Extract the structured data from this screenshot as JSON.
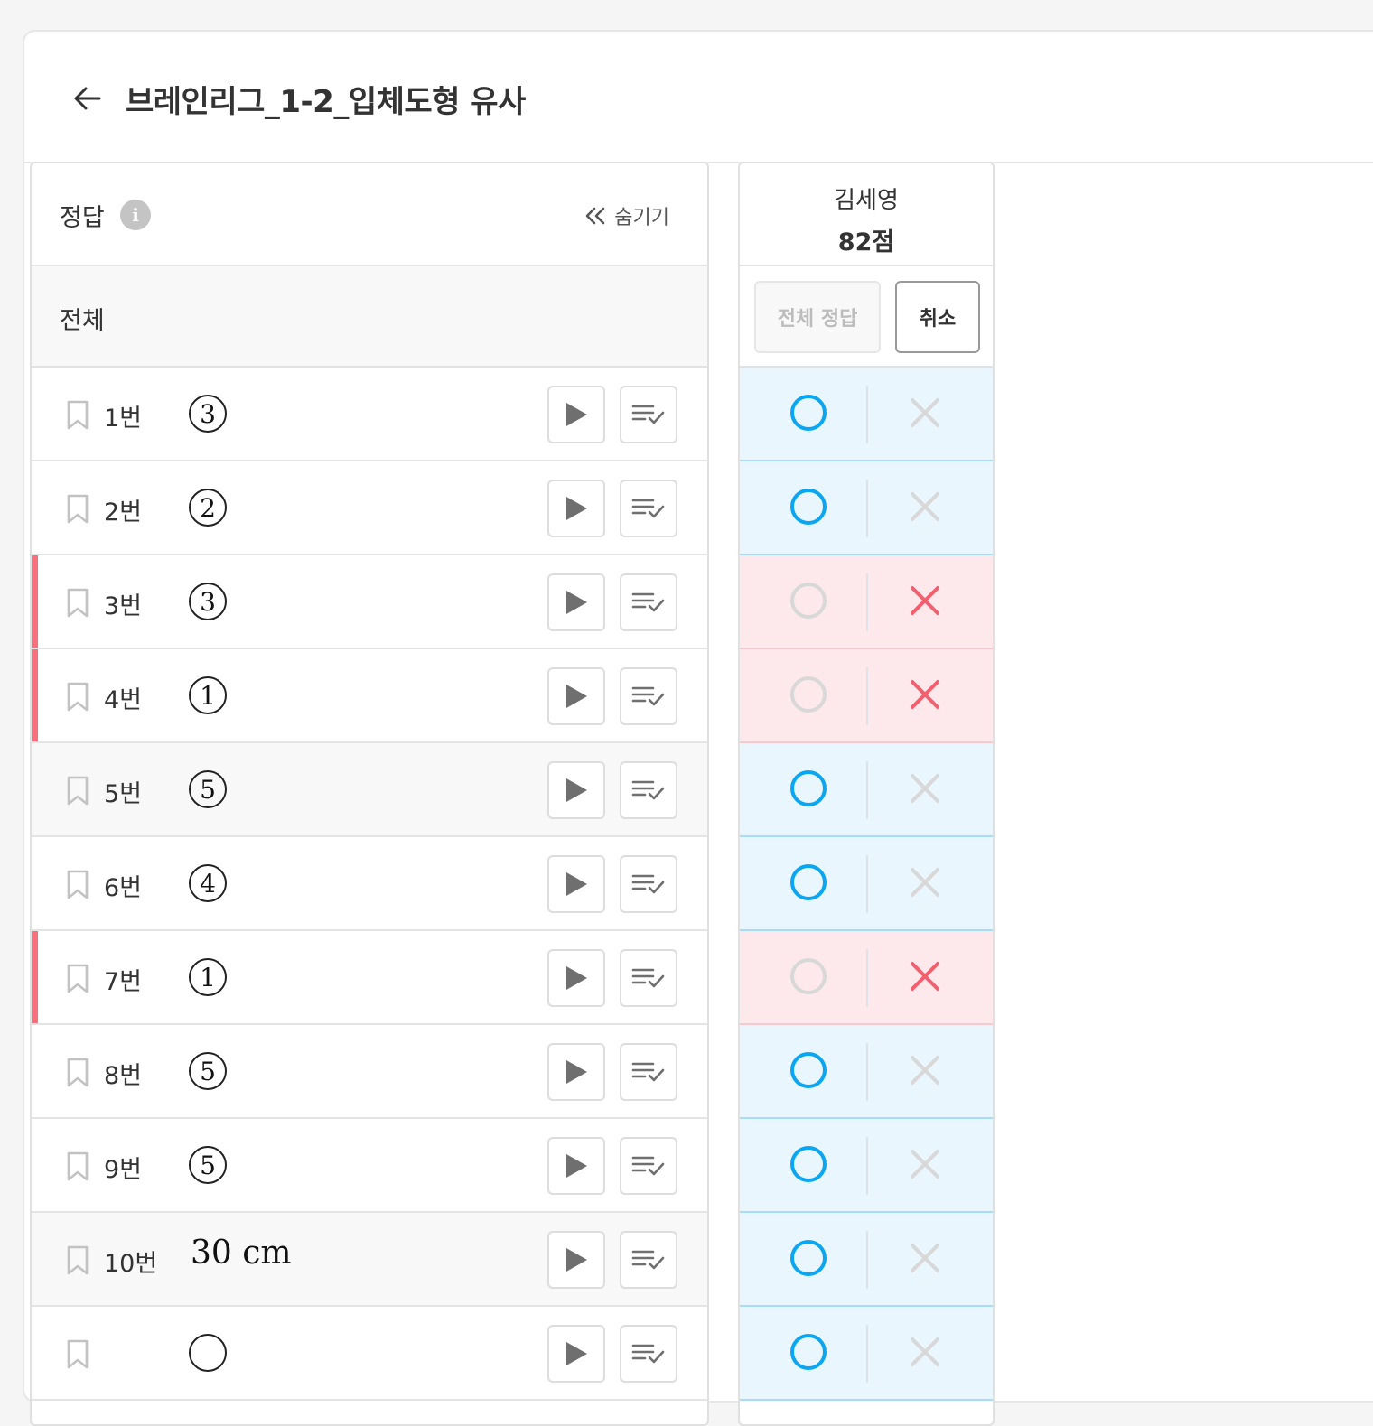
{
  "header": {
    "title": "브레인리그_1-2_입체도형 유사"
  },
  "answer_panel": {
    "title": "정답",
    "hide_label": "숨기기",
    "all_label": "전체",
    "questions": [
      {
        "num": "1번",
        "answer": "3",
        "type": "circled",
        "shaded": false,
        "wrong": false
      },
      {
        "num": "2번",
        "answer": "2",
        "type": "circled",
        "shaded": false,
        "wrong": false
      },
      {
        "num": "3번",
        "answer": "3",
        "type": "circled",
        "shaded": false,
        "wrong": true
      },
      {
        "num": "4번",
        "answer": "1",
        "type": "circled",
        "shaded": false,
        "wrong": true
      },
      {
        "num": "5번",
        "answer": "5",
        "type": "circled",
        "shaded": true,
        "wrong": false
      },
      {
        "num": "6번",
        "answer": "4",
        "type": "circled",
        "shaded": false,
        "wrong": false
      },
      {
        "num": "7번",
        "answer": "1",
        "type": "circled",
        "shaded": false,
        "wrong": true
      },
      {
        "num": "8번",
        "answer": "5",
        "type": "circled",
        "shaded": false,
        "wrong": false
      },
      {
        "num": "9번",
        "answer": "5",
        "type": "circled",
        "shaded": false,
        "wrong": false
      },
      {
        "num": "10번",
        "answer": "30 cm",
        "type": "text",
        "shaded": true,
        "wrong": false
      },
      {
        "num": "",
        "answer": "",
        "type": "circled",
        "shaded": false,
        "wrong": false
      }
    ]
  },
  "student": {
    "name": "김세영",
    "score": "82점",
    "all_correct_label": "전체 정답",
    "cancel_label": "취소",
    "results": [
      "correct",
      "correct",
      "incorrect",
      "incorrect",
      "correct",
      "correct",
      "incorrect",
      "correct",
      "correct",
      "correct",
      "correct"
    ]
  },
  "colors": {
    "correct_blue": "#0aa6f0",
    "incorrect_red": "#f25f6e",
    "faded": "#d8d8d8"
  }
}
